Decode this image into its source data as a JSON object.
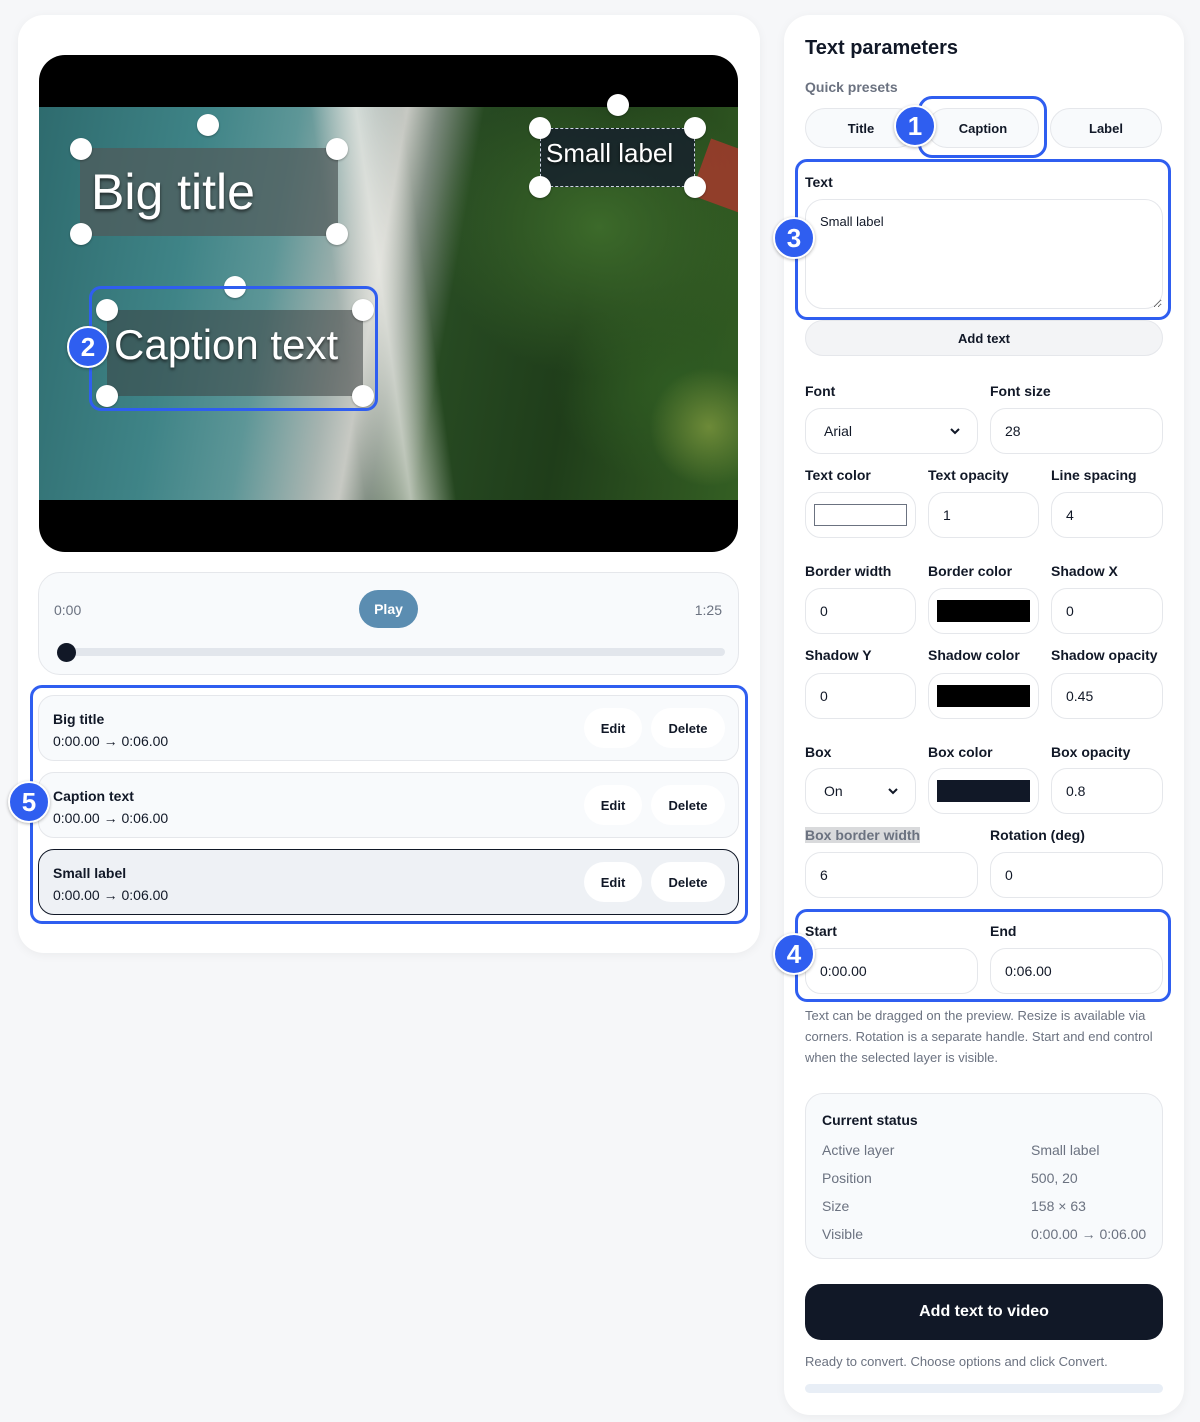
{
  "preview": {
    "overlays": {
      "big_title": "Big title",
      "caption_text": "Caption text",
      "small_label": "Small label"
    }
  },
  "controls": {
    "current_time": "0:00",
    "duration": "1:25",
    "play_label": "Play",
    "scrub_position": 0
  },
  "layers": [
    {
      "name": "Big title",
      "time": "0:00.00 → 0:06.00",
      "edit_label": "Edit",
      "delete_label": "Delete"
    },
    {
      "name": "Caption text",
      "time": "0:00.00 → 0:06.00",
      "edit_label": "Edit",
      "delete_label": "Delete"
    },
    {
      "name": "Small label",
      "time": "0:00.00 → 0:06.00",
      "edit_label": "Edit",
      "delete_label": "Delete",
      "selected": true
    }
  ],
  "panel": {
    "title": "Text parameters",
    "quick_presets_label": "Quick presets",
    "presets": [
      "Title",
      "Caption",
      "Label"
    ],
    "text_label": "Text",
    "text_value": "Small label",
    "add_text_label": "Add text",
    "font_label": "Font",
    "font_value": "Arial",
    "font_size_label": "Font size",
    "font_size_value": "28",
    "text_color_label": "Text color",
    "text_color": "#ffffff",
    "text_opacity_label": "Text opacity",
    "text_opacity_value": "1",
    "line_spacing_label": "Line spacing",
    "line_spacing_value": "4",
    "border_width_label": "Border width",
    "border_width_value": "0",
    "border_color_label": "Border color",
    "border_color": "#000000",
    "shadow_x_label": "Shadow X",
    "shadow_x_value": "0",
    "shadow_y_label": "Shadow Y",
    "shadow_y_value": "0",
    "shadow_color_label": "Shadow color",
    "shadow_color": "#000000",
    "shadow_opacity_label": "Shadow opacity",
    "shadow_opacity_value": "0.45",
    "box_label": "Box",
    "box_value": "On",
    "box_color_label": "Box color",
    "box_color": "#111827",
    "box_opacity_label": "Box opacity",
    "box_opacity_value": "0.8",
    "box_border_width_label": "Box border width",
    "box_border_width_value": "6",
    "rotation_label": "Rotation (deg)",
    "rotation_value": "0",
    "start_label": "Start",
    "start_value": "0:00.00",
    "end_label": "End",
    "end_value": "0:06.00",
    "help_text": "Text can be dragged on the preview. Resize is available via corners. Rotation is a separate handle. Start and end control when the selected layer is visible.",
    "status": {
      "title": "Current status",
      "active_layer_label": "Active layer",
      "active_layer_value": "Small label",
      "position_label": "Position",
      "position_value": "500, 20",
      "size_label": "Size",
      "size_value": "158 × 63",
      "visible_label": "Visible",
      "visible_value": "0:00.00 → 0:06.00"
    },
    "submit_label": "Add text to video",
    "ready_text": "Ready to convert. Choose options and click Convert."
  },
  "annotations": [
    "1",
    "2",
    "3",
    "4",
    "5"
  ],
  "colors": {
    "annotation_blue": "#2f5ef0",
    "play_button": "#5b8db1",
    "primary_button": "#111827"
  }
}
